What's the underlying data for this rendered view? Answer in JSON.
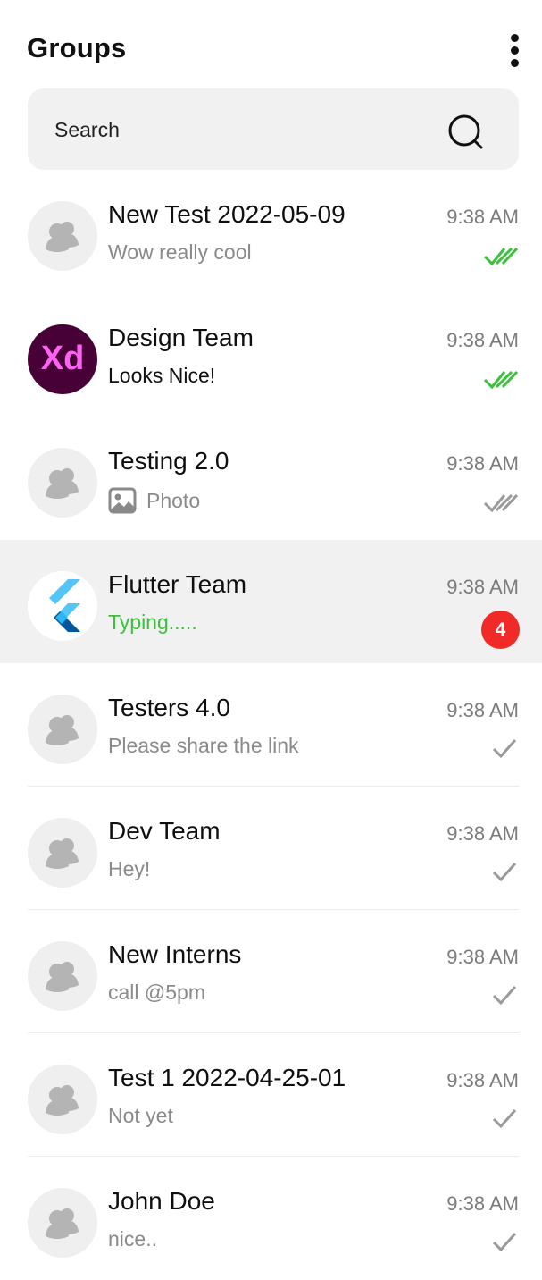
{
  "header": {
    "title": "Groups",
    "more_icon": "more-vertical-icon"
  },
  "search": {
    "placeholder": "Search",
    "icon": "search-icon"
  },
  "colors": {
    "read_tick": "#3cc13c",
    "delivered_tick": "#9a9a9a",
    "typing": "#3cc13c",
    "unread_badge": "#f02b27",
    "active_row": "#f1f1f1",
    "xd_background": "#470137",
    "xd_foreground": "#ff61f6"
  },
  "groups": [
    {
      "name": "New Test 2022-05-09",
      "message": "Wow really cool",
      "time": "9:38 AM",
      "status": "read",
      "avatar": "group-icon"
    },
    {
      "name": "Design Team",
      "message": "Looks Nice!",
      "time": "9:38 AM",
      "status": "read",
      "avatar": "adobe-xd-logo",
      "avatar_text": "Xd"
    },
    {
      "name": "Testing 2.0",
      "message": "Photo",
      "time": "9:38 AM",
      "status": "delivered",
      "avatar": "group-icon",
      "message_icon": "photo-icon"
    },
    {
      "name": "Flutter Team",
      "message": "Typing.....",
      "time": "9:38 AM",
      "status": "unread",
      "unread_count": "4",
      "avatar": "flutter-logo"
    },
    {
      "name": "Testers 4.0",
      "message": "Please share the link",
      "time": "9:38 AM",
      "status": "sent",
      "avatar": "group-icon"
    },
    {
      "name": "Dev Team",
      "message": "Hey!",
      "time": "9:38 AM",
      "status": "sent",
      "avatar": "group-icon"
    },
    {
      "name": "New Interns",
      "message": "call @5pm",
      "time": "9:38 AM",
      "status": "sent",
      "avatar": "group-icon"
    },
    {
      "name": "Test 1 2022-04-25-01",
      "message": "Not yet",
      "time": "9:38 AM",
      "status": "sent",
      "avatar": "group-icon"
    },
    {
      "name": "John Doe",
      "message": "nice..",
      "time": "9:38 AM",
      "status": "sent",
      "avatar": "group-icon"
    }
  ]
}
